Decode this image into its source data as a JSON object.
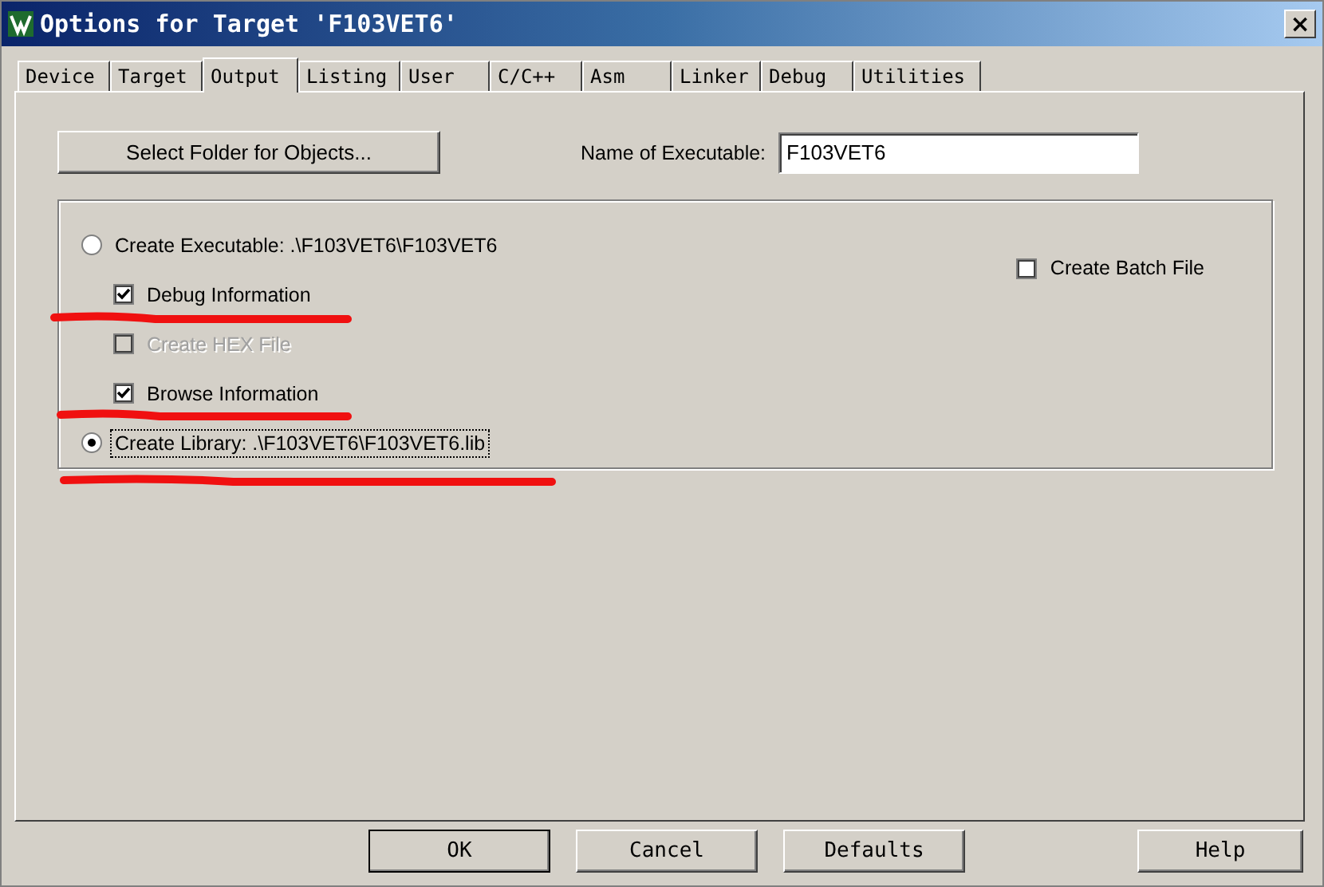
{
  "window": {
    "title": "Options for Target 'F103VET6'",
    "close": "×"
  },
  "tabs": [
    {
      "label": "Device",
      "selected": false
    },
    {
      "label": "Target",
      "selected": false
    },
    {
      "label": "Output",
      "selected": true
    },
    {
      "label": "Listing",
      "selected": false
    },
    {
      "label": "User",
      "selected": false
    },
    {
      "label": "C/C++",
      "selected": false
    },
    {
      "label": "Asm",
      "selected": false
    },
    {
      "label": "Linker",
      "selected": false
    },
    {
      "label": "Debug",
      "selected": false
    },
    {
      "label": "Utilities",
      "selected": false
    }
  ],
  "select_folder_button": "Select Folder for Objects...",
  "executable_name": {
    "label": "Name of Executable:",
    "value": "F103VET6"
  },
  "options": [
    {
      "kind": "radio",
      "label": "Create Executable:  .\\F103VET6\\F103VET6",
      "selected": false,
      "indented": false,
      "disabled": false,
      "focused": false,
      "annotated": false
    },
    {
      "kind": "checkbox",
      "label": "Debug Information",
      "checked": true,
      "indented": true,
      "disabled": false,
      "focused": false,
      "annotated": true
    },
    {
      "kind": "checkbox",
      "label": "Create HEX File",
      "checked": false,
      "indented": true,
      "disabled": true,
      "focused": false,
      "annotated": false
    },
    {
      "kind": "checkbox",
      "label": "Browse Information",
      "checked": true,
      "indented": true,
      "disabled": false,
      "focused": false,
      "annotated": true
    },
    {
      "kind": "radio",
      "label": "Create Library:  .\\F103VET6\\F103VET6.lib",
      "selected": true,
      "indented": false,
      "disabled": false,
      "focused": true,
      "annotated": true
    }
  ],
  "batch_file": {
    "label": "Create Batch File",
    "checked": false
  },
  "buttons": [
    {
      "label": "OK",
      "default": true
    },
    {
      "label": "Cancel",
      "default": false
    },
    {
      "label": "Defaults",
      "default": false
    },
    {
      "label": "Help",
      "default": false
    }
  ]
}
